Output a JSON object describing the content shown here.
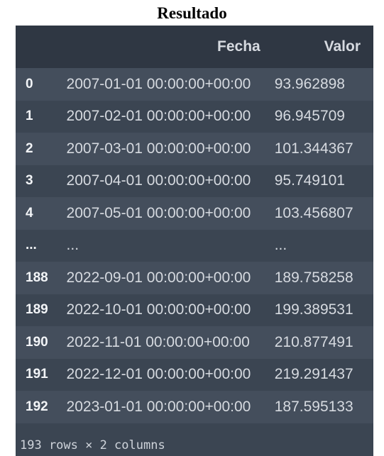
{
  "title": "Resultado",
  "table": {
    "columns": [
      "",
      "Fecha",
      "Valor"
    ],
    "rows": [
      {
        "index": "0",
        "fecha": "2007-01-01 00:00:00+00:00",
        "valor": "93.962898"
      },
      {
        "index": "1",
        "fecha": "2007-02-01 00:00:00+00:00",
        "valor": "96.945709"
      },
      {
        "index": "2",
        "fecha": "2007-03-01 00:00:00+00:00",
        "valor": "101.344367"
      },
      {
        "index": "3",
        "fecha": "2007-04-01 00:00:00+00:00",
        "valor": "95.749101"
      },
      {
        "index": "4",
        "fecha": "2007-05-01 00:00:00+00:00",
        "valor": "103.456807"
      },
      {
        "index": "...",
        "fecha": "...",
        "valor": "..."
      },
      {
        "index": "188",
        "fecha": "2022-09-01 00:00:00+00:00",
        "valor": "189.758258"
      },
      {
        "index": "189",
        "fecha": "2022-10-01 00:00:00+00:00",
        "valor": "199.389531"
      },
      {
        "index": "190",
        "fecha": "2022-11-01 00:00:00+00:00",
        "valor": "210.877491"
      },
      {
        "index": "191",
        "fecha": "2022-12-01 00:00:00+00:00",
        "valor": "219.291437"
      },
      {
        "index": "192",
        "fecha": "2023-01-01 00:00:00+00:00",
        "valor": "187.595133"
      }
    ]
  },
  "footer": "193 rows × 2 columns",
  "colors": {
    "panel": "#3b4552",
    "header": "#2f3743",
    "alt_row": "#444e5c"
  }
}
